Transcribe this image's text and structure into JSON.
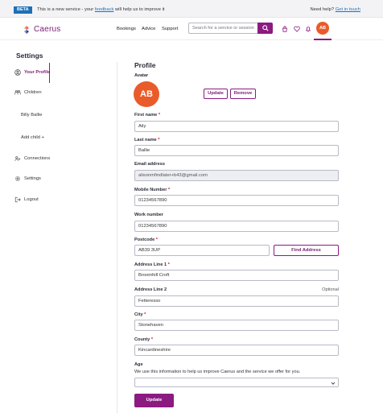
{
  "beta_banner": {
    "tag": "BETA",
    "text_before": "This is a new service - your ",
    "feedback_link": "feedback",
    "text_after": " will help us to improve it",
    "help_text": "Need help? ",
    "help_link": "Get in touch"
  },
  "header": {
    "brand": "Caerus",
    "nav": [
      "Bookings",
      "Advice",
      "Support"
    ],
    "search_placeholder": "Search for a service or session",
    "user_initials": "AB",
    "icons": [
      "basket-icon",
      "heart-icon",
      "bell-icon"
    ]
  },
  "sidebar": {
    "title": "Settings",
    "items": [
      {
        "label": "Your Profile",
        "icon": "user-circle-icon",
        "active": true
      },
      {
        "label": "Children",
        "icon": "children-icon",
        "active": false
      },
      {
        "label": "Billy Ballie",
        "sub": true
      },
      {
        "label": "Add child +",
        "sub": true
      },
      {
        "label": "Connections",
        "icon": "connections-icon",
        "active": false
      },
      {
        "label": "Settings",
        "icon": "gear-icon",
        "active": false
      },
      {
        "label": "Logout",
        "icon": "logout-icon",
        "active": false
      }
    ]
  },
  "profile": {
    "title": "Profile",
    "avatar_label": "Avatar",
    "avatar_initials": "AB",
    "update_button": "Update",
    "remove_button": "Remove",
    "fields": {
      "first_name": {
        "label": "First name",
        "required": "*",
        "value": "Aily"
      },
      "last_name": {
        "label": "Last name",
        "required": "*",
        "value": "Ballie"
      },
      "email": {
        "label": "Email address",
        "value": "alisonmfindlater+b43@gmail.com"
      },
      "mobile": {
        "label": "Mobile Number",
        "required": "*",
        "value": "01234567890"
      },
      "work": {
        "label": "Work number",
        "value": "01234567890"
      },
      "postcode": {
        "label": "Postcode",
        "required": "*",
        "value": "AB39 3UP",
        "button": "Find Address"
      },
      "address1": {
        "label": "Address Line 1",
        "required": "*",
        "value": "Broomhill Croft"
      },
      "address2": {
        "label": "Address Line 2",
        "optional": "Optional",
        "value": "Fetteresso"
      },
      "city": {
        "label": "City",
        "required": "*",
        "value": "Stonehaven"
      },
      "county": {
        "label": "County",
        "required": "*",
        "value": "Kincardineshire"
      },
      "age": {
        "label": "Age",
        "helper": "We use this information to help us improve Caerus and the service we offer for you.",
        "value": ""
      }
    },
    "submit_button": "Update"
  },
  "colors": {
    "brand": "#8b1a81",
    "avatar": "#ea5b2a",
    "beta": "#1d70b8",
    "required": "#c8102e"
  }
}
